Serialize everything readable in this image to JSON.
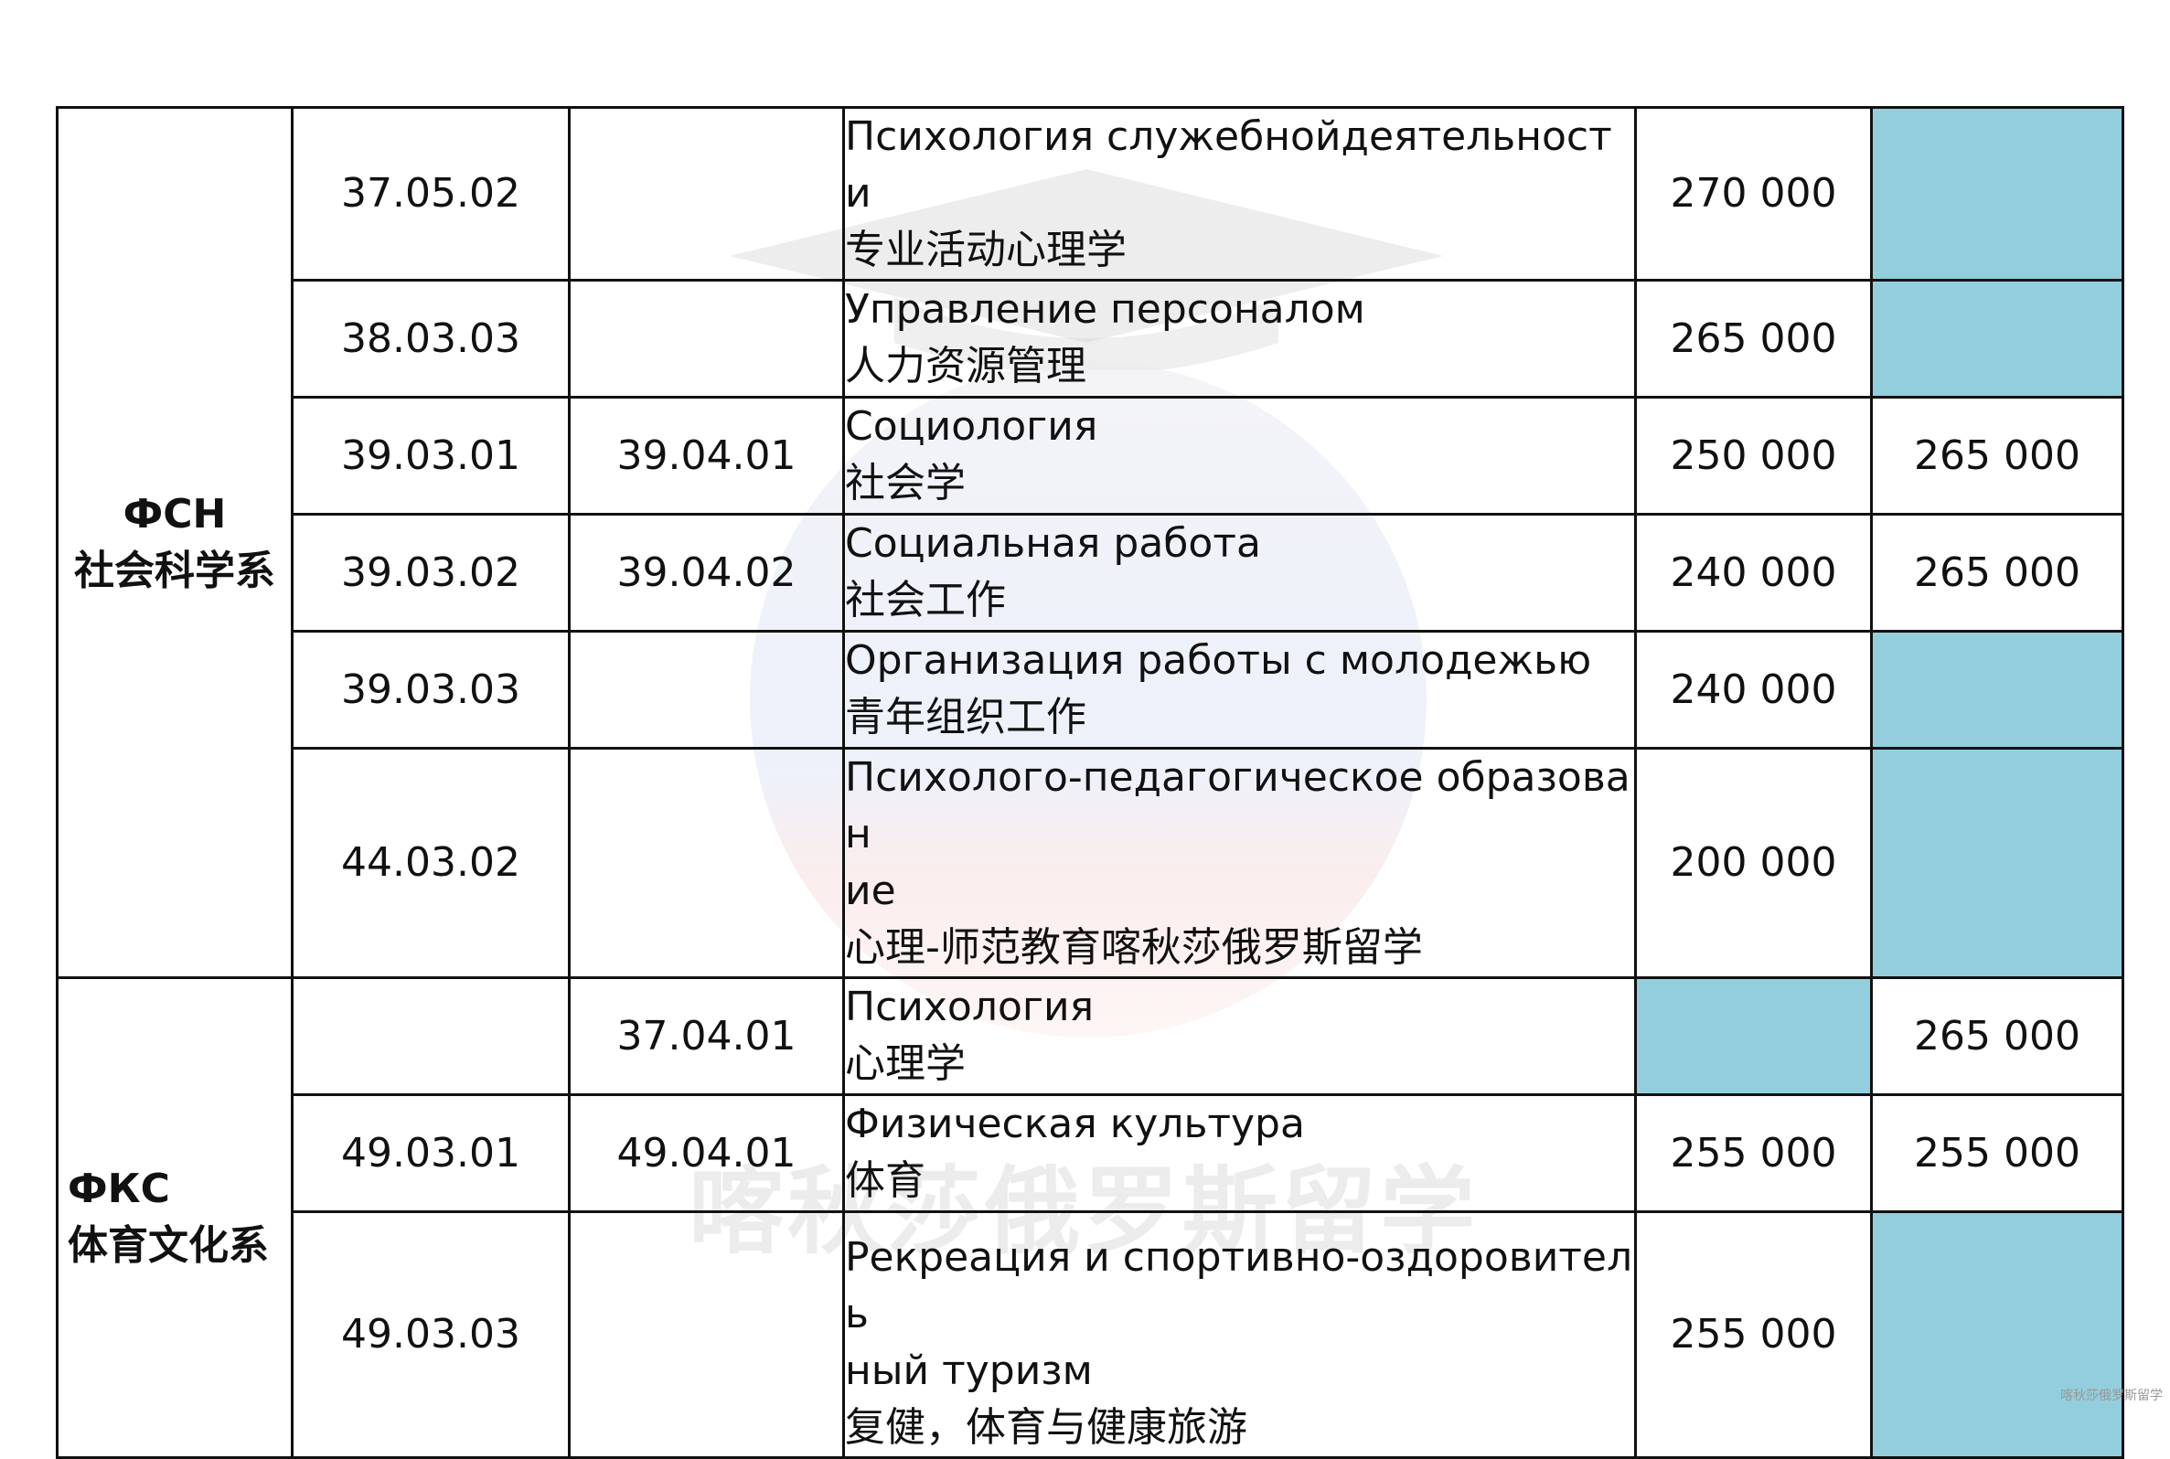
{
  "watermark": {
    "text": "喀秋莎俄罗斯留学"
  },
  "footer": {
    "text": "喀秋莎俄罗斯留学"
  },
  "colors": {
    "empty_cell": "#93cedd",
    "border": "#111111"
  },
  "departments": [
    {
      "code": "ФСН",
      "name": "社会科学系"
    },
    {
      "code": "ФКС",
      "name": "体育文化系"
    }
  ],
  "rows": [
    {
      "bachelor": "37.05.02",
      "master": "",
      "name_ru": "Психология служебнойдеятельности",
      "name_zh": "专业活动心理学",
      "price_bachelor": "270 000",
      "price_master": ""
    },
    {
      "bachelor": "38.03.03",
      "master": "",
      "name_ru": "Управление персоналом",
      "name_zh": "人力资源管理",
      "price_bachelor": "265 000",
      "price_master": ""
    },
    {
      "bachelor": "39.03.01",
      "master": "39.04.01",
      "name_ru": "Социология",
      "name_zh": "社会学",
      "price_bachelor": "250 000",
      "price_master": "265 000"
    },
    {
      "bachelor": "39.03.02",
      "master": "39.04.02",
      "name_ru": "Социальная работа",
      "name_zh": "社会工作",
      "price_bachelor": "240 000",
      "price_master": "265 000"
    },
    {
      "bachelor": "39.03.03",
      "master": "",
      "name_ru": "Организация работы с молодежью",
      "name_zh": "青年组织工作",
      "price_bachelor": "240 000",
      "price_master": ""
    },
    {
      "bachelor": "44.03.02",
      "master": "",
      "name_ru_1": "Психолого-педагогическое образован",
      "name_ru_2": "ие",
      "name_zh": "心理-师范教育喀秋莎俄罗斯留学",
      "price_bachelor": "200 000",
      "price_master": ""
    },
    {
      "bachelor": "",
      "master": "37.04.01",
      "name_ru": "Психология",
      "name_zh": "心理学",
      "price_bachelor": "",
      "price_master": "265 000"
    },
    {
      "bachelor": "49.03.01",
      "master": "49.04.01",
      "name_ru": "Физическая культура",
      "name_zh": "体育",
      "price_bachelor": "255 000",
      "price_master": "255 000"
    },
    {
      "bachelor": "49.03.03",
      "master": "",
      "name_ru_1": "Рекреация и спортивно-оздоровитель",
      "name_ru_2": "ный туризм",
      "name_zh": "复健，体育与健康旅游",
      "price_bachelor": "255 000",
      "price_master": ""
    }
  ]
}
